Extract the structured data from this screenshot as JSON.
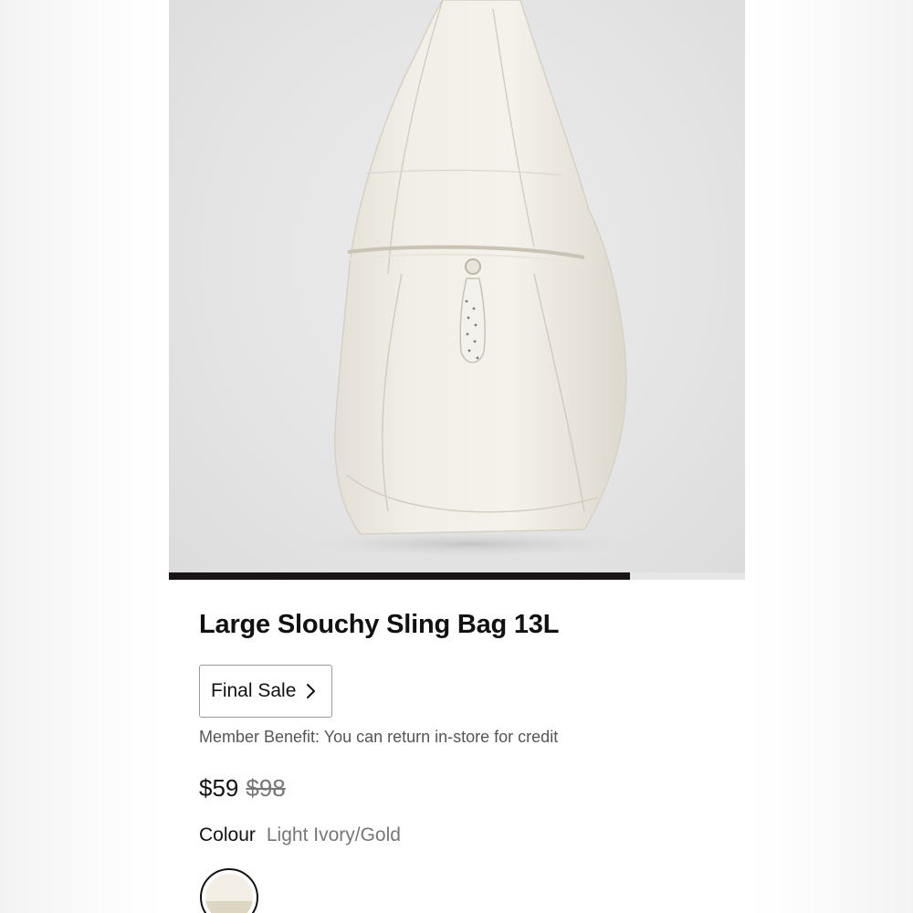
{
  "product": {
    "title": "Large Slouchy Sling Bag 13L",
    "final_sale_label": "Final Sale",
    "member_benefit": "Member Benefit: You can return in-store for credit",
    "price": "$59",
    "original_price": "$98",
    "colour_label": "Colour",
    "colour_value": "Light Ivory/Gold",
    "swatch_colors": [
      "#f3efe6",
      "#ddd6c2"
    ]
  },
  "gallery": {
    "progress": 0.8
  },
  "colors": {
    "progress_fill": "#1b1416",
    "progress_track": "#e6e6e6",
    "text_primary": "#111111",
    "text_secondary": "#777777",
    "bag_fabric": "#f2efe8"
  },
  "icons": {
    "final_sale_chevron": "chevron-right-icon"
  }
}
